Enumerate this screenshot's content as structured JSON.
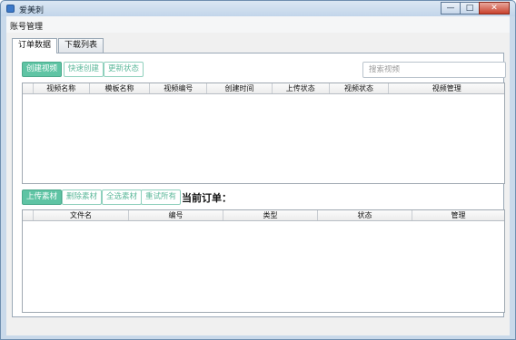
{
  "window": {
    "title": "爱美刺",
    "minimize_glyph": "—",
    "maximize_glyph": "□",
    "close_glyph": "✕"
  },
  "menu": {
    "account": "账号管理"
  },
  "tabs": [
    {
      "label": "订单数据",
      "active": true
    },
    {
      "label": "下载列表",
      "active": false
    }
  ],
  "video_toolbar": {
    "create_video": "创建视频",
    "quick_create": "快速创建",
    "refresh_status": "更新状态",
    "search_placeholder": "搜索视频"
  },
  "video_table": {
    "columns": [
      "视频名称",
      "模板名称",
      "视频编号",
      "创建时间",
      "上传状态",
      "视频状态",
      "视频管理"
    ],
    "rows": []
  },
  "material_toolbar": {
    "upload": "上传素材",
    "delete": "删除素材",
    "select_all": "全选素材",
    "retry_all": "重试所有",
    "current_order_label": "当前订单："
  },
  "material_table": {
    "columns": [
      "文件名",
      "编号",
      "类型",
      "状态",
      "管理"
    ],
    "rows": []
  },
  "colors": {
    "accent": "#5fc4a4",
    "accent_border": "#8fd0bd",
    "title_bar": "#c9d9ea",
    "close_button": "#c9412d"
  }
}
